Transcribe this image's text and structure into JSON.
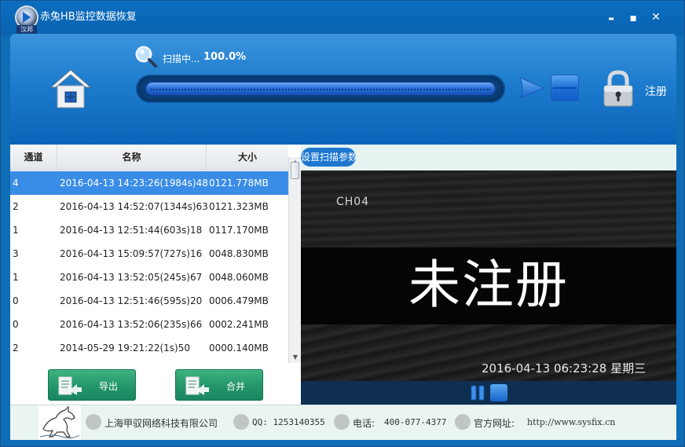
{
  "window": {
    "title": "赤兔HB监控数据恢复",
    "logo_tag": "汉邦",
    "minimize_glyph": "▬",
    "maximize_glyph": "■",
    "close_glyph": "✕"
  },
  "header": {
    "scan_label": "扫描中...",
    "scan_percent": "100.0%",
    "progress_fraction": 1.0,
    "register_label": "注册",
    "icons": [
      "home-icon",
      "search-icon",
      "play-icon",
      "stop-icon",
      "lock-icon"
    ]
  },
  "list": {
    "columns": [
      "通道",
      "名称",
      "大小"
    ],
    "rows": [
      {
        "channel": "4",
        "name": "2016-04-13 14:23:26(1984s)48",
        "size": "0121.778MB"
      },
      {
        "channel": "2",
        "name": "2016-04-13 14:52:07(1344s)63",
        "size": "0121.323MB"
      },
      {
        "channel": "1",
        "name": "2016-04-13 12:51:44(603s)18",
        "size": "0117.170MB"
      },
      {
        "channel": "3",
        "name": "2016-04-13 15:09:57(727s)16",
        "size": "0048.830MB"
      },
      {
        "channel": "1",
        "name": "2016-04-13 13:52:05(245s)67",
        "size": "0048.060MB"
      },
      {
        "channel": "0",
        "name": "2016-04-13 12:51:46(595s)20",
        "size": "0006.479MB"
      },
      {
        "channel": "0",
        "name": "2016-04-13 13:52:06(235s)66",
        "size": "0002.241MB"
      },
      {
        "channel": "2",
        "name": "2014-05-29 19:21:22(1s)50",
        "size": "0000.140MB"
      }
    ],
    "selected_index": 0
  },
  "buttons": {
    "export": "导出",
    "merge": "合并"
  },
  "video": {
    "param_button": "设置扫描参数",
    "channel_label": "CH04",
    "watermark": "未注册",
    "timestamp": "2016-04-13 06:23:28 星期三"
  },
  "footer": {
    "company": "上海甲驭网络科技有限公司",
    "qq": "QQ: 1253140355",
    "phone_label": "电话:",
    "phone": "400-077-4377",
    "website_label": "官方网址:",
    "website": "http://www.sysfix.cn"
  },
  "colors": {
    "title_bar": "#0b6dbf",
    "header_gradient_top": "#3c94dc",
    "header_gradient_bottom": "#0b63b8",
    "selected_row": "#3a8de6",
    "action_button": "#23956a",
    "footer_bg": "#eaf5f2"
  }
}
